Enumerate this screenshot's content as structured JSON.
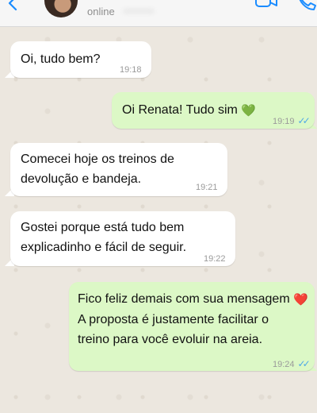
{
  "header": {
    "status": "online"
  },
  "messages": [
    {
      "text": "Oi, tudo bem?",
      "time": "19:18",
      "direction": "in"
    },
    {
      "text": "Oi Renata! Tudo sim",
      "emoji": "💚",
      "time": "19:19",
      "direction": "out",
      "ticks": "✓✓"
    },
    {
      "text": "Comecei hoje os treinos de\ndevolução e bandeja.",
      "time": "19:21",
      "direction": "in"
    },
    {
      "text": "Gostei porque está tudo bem\nexplicadinho e fácil de seguir.",
      "time": "19:22",
      "direction": "in"
    },
    {
      "text_line1": "Fico feliz demais com sua mensagem",
      "emoji": "❤️",
      "text_rest": "A proposta é justamente facilitar o\ntreino para você evoluir na areia.",
      "time": "19:24",
      "direction": "out",
      "ticks": "✓✓"
    }
  ],
  "colors": {
    "incoming": "#ffffff",
    "outgoing": "#dcf8c6",
    "read_tick": "#4fa9e6",
    "ios_blue": "#1a8cff"
  },
  "icons": [
    "back-chevron-icon",
    "video-call-icon",
    "phone-call-icon"
  ]
}
